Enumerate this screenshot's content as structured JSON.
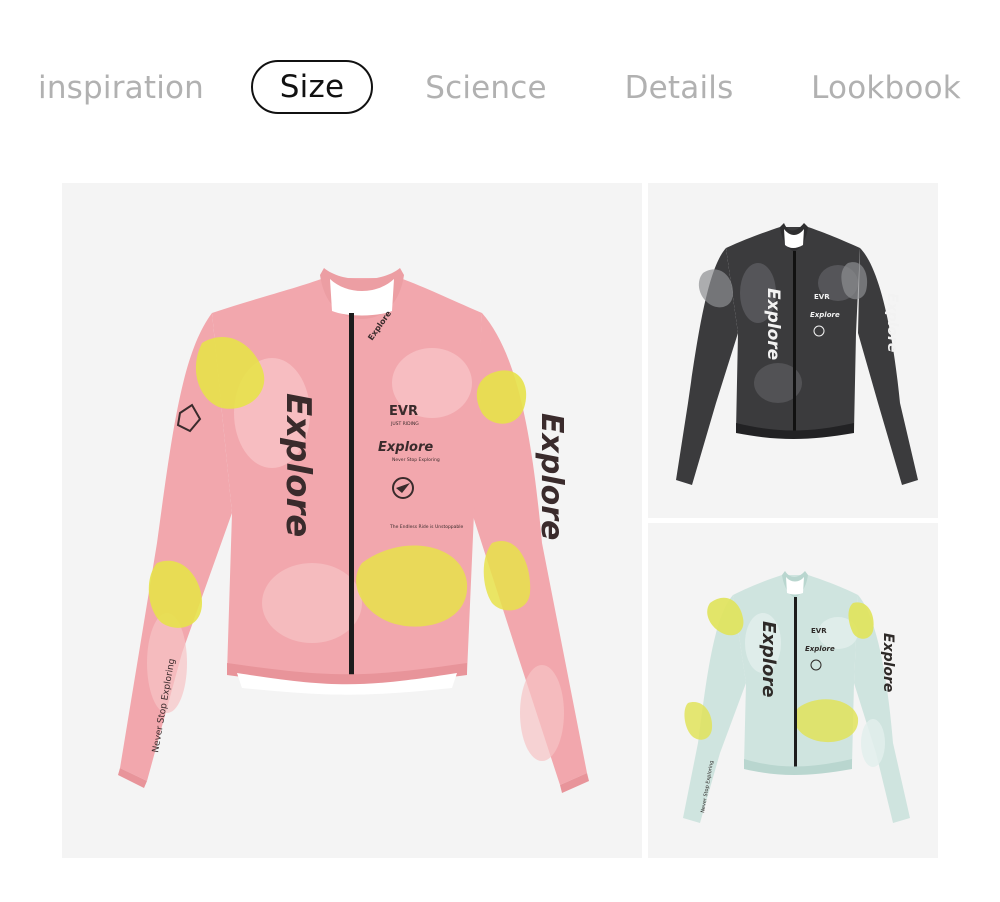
{
  "tabs": [
    {
      "label": "inspiration",
      "active": false
    },
    {
      "label": "Size",
      "active": true
    },
    {
      "label": "Science",
      "active": false
    },
    {
      "label": "Details",
      "active": false
    },
    {
      "label": "Lookbook",
      "active": false
    }
  ],
  "products": {
    "main": {
      "color": "pink",
      "print": {
        "brand": "EVR",
        "brand_sub": "JUST RIDING",
        "explore": "Explore",
        "tagline": "Never Stop Exploring",
        "chest_text": "Explore",
        "chest_sub": "Never Stop Exploring",
        "small_print": "The Endless Ride is Unstoppable",
        "sleeve_text": "Never Stop Exploring",
        "collar_text": "Explore"
      },
      "colors": {
        "base": "#f2a7ad",
        "light": "#f7c3c5",
        "accent": "#e7e24a",
        "ink": "#3a2b2c"
      }
    },
    "top": {
      "color": "black",
      "print": {
        "brand": "EVR",
        "explore": "Explore",
        "chest_text": "Explore"
      },
      "colors": {
        "base": "#3b3b3d",
        "light": "#5c5d60",
        "accent": "#8d8e91",
        "ink": "#f2f2f2"
      }
    },
    "bottom": {
      "color": "mint",
      "print": {
        "brand": "EVR",
        "explore": "Explore",
        "chest_text": "Explore",
        "sleeve_text": "Never Stop Exploring"
      },
      "colors": {
        "base": "#cfe4df",
        "light": "#e2efec",
        "accent": "#e0e35a",
        "ink": "#2e2a28"
      }
    }
  }
}
